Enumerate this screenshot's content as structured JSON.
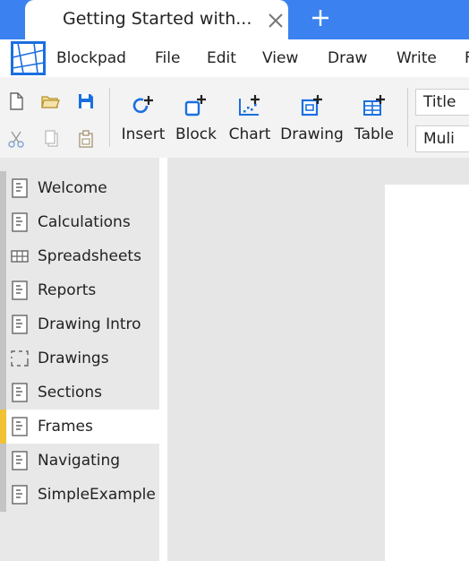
{
  "tab": {
    "title": "Getting Started with..."
  },
  "app": {
    "name": "Blockpad"
  },
  "menu": [
    "File",
    "Edit",
    "View",
    "Draw",
    "Write",
    "F"
  ],
  "toolbar": {
    "tools": [
      {
        "label": "Insert",
        "icon": "insert-icon"
      },
      {
        "label": "Block",
        "icon": "block-icon"
      },
      {
        "label": "Chart",
        "icon": "chart-icon"
      },
      {
        "label": "Drawing",
        "icon": "drawing-icon"
      },
      {
        "label": "Table",
        "icon": "table-icon"
      }
    ],
    "style_select": "Title",
    "font_select": "Muli"
  },
  "sidebar": {
    "items": [
      {
        "label": "Welcome",
        "icon": "document-icon"
      },
      {
        "label": "Calculations",
        "icon": "document-icon"
      },
      {
        "label": "Spreadsheets",
        "icon": "spreadsheet-icon"
      },
      {
        "label": "Reports",
        "icon": "document-icon"
      },
      {
        "label": "Drawing Intro",
        "icon": "document-icon"
      },
      {
        "label": "Drawings",
        "icon": "drawing-frame-icon"
      },
      {
        "label": "Sections",
        "icon": "document-icon"
      },
      {
        "label": "Frames",
        "icon": "document-icon",
        "active": true
      },
      {
        "label": "Navigating",
        "icon": "document-icon"
      },
      {
        "label": "SimpleExample",
        "icon": "document-icon"
      }
    ]
  },
  "colors": {
    "tabbar": "#3b82f0",
    "accent_blue": "#1a6fe0",
    "active_marker": "#f1c232"
  }
}
